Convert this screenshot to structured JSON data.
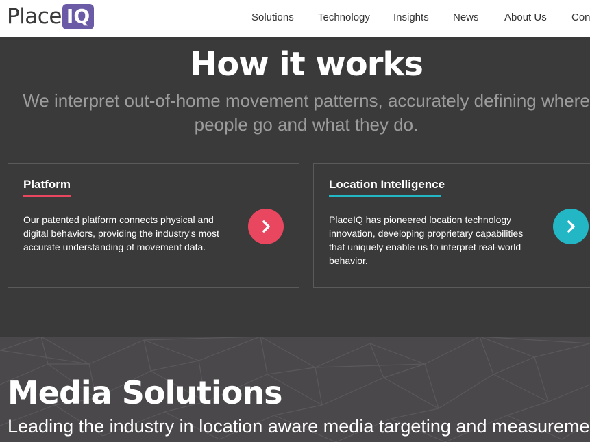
{
  "header": {
    "logo_place": "Place",
    "logo_iq": "IQ",
    "nav": [
      {
        "label": "Solutions"
      },
      {
        "label": "Technology"
      },
      {
        "label": "Insights"
      },
      {
        "label": "News"
      },
      {
        "label": "About Us"
      },
      {
        "label": "Cont"
      }
    ]
  },
  "how_it_works": {
    "title": "How it works",
    "subtitle_line1": "We interpret out-of-home movement patterns, accurately defining where",
    "subtitle_line2": "people go and what they do.",
    "cards": [
      {
        "title": "Platform",
        "accent": "#e8475f",
        "lines": [
          "Our patented platform connects physical and",
          "digital behaviors, providing the industry's most",
          "accurate understanding of movement data."
        ],
        "button_icon": "chevron-right-icon"
      },
      {
        "title": "Location Intelligence",
        "accent": "#23b7c6",
        "lines": [
          "PlaceIQ has pioneered location technology",
          "innovation, developing proprietary capabilities",
          "that uniquely enable us to interpret real-world",
          "behavior."
        ],
        "button_icon": "chevron-right-icon"
      }
    ]
  },
  "media_solutions": {
    "title": "Media Solutions",
    "subtitle": "Leading the industry in location aware media targeting and measurement."
  },
  "colors": {
    "brand_purple": "#6b5aa6",
    "background_dark": "#3a3a3a",
    "pink_accent": "#e8475f",
    "teal_accent": "#23b7c6"
  }
}
